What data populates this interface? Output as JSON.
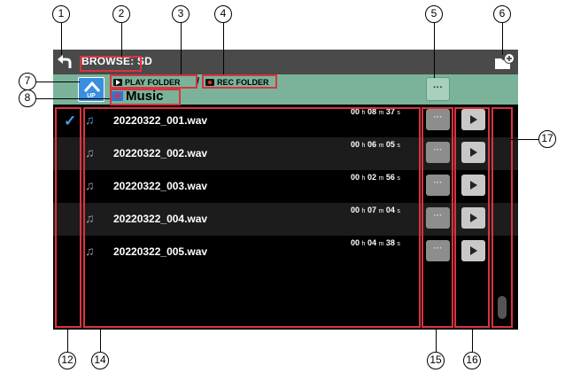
{
  "header": {
    "title": "BROWSE: SD",
    "back_icon": "back-arrow-icon",
    "new_folder_icon": "new-folder-icon"
  },
  "folder_bar": {
    "up_label": "UP",
    "play_folder_label": "PLAY FOLDER",
    "separator": "/",
    "rec_folder_label": "REC FOLDER",
    "current_folder": "Music",
    "menu_label": "···"
  },
  "files": [
    {
      "name": "20220322_001.wav",
      "h": "00",
      "m": "08",
      "s": "37",
      "selected": true
    },
    {
      "name": "20220322_002.wav",
      "h": "00",
      "m": "06",
      "s": "05",
      "selected": false
    },
    {
      "name": "20220322_003.wav",
      "h": "00",
      "m": "02",
      "s": "56",
      "selected": false
    },
    {
      "name": "20220322_004.wav",
      "h": "00",
      "m": "07",
      "s": "04",
      "selected": false
    },
    {
      "name": "20220322_005.wav",
      "h": "00",
      "m": "04",
      "s": "38",
      "selected": false
    }
  ],
  "units": {
    "h": "h",
    "m": "m",
    "s": "s"
  },
  "row_menu_label": "···",
  "callouts": {
    "c1": "1",
    "c2": "2",
    "c3": "3",
    "c4": "4",
    "c5": "5",
    "c6": "6",
    "c7": "7",
    "c8": "8",
    "c12": "12",
    "c14": "14",
    "c15": "15",
    "c16": "16",
    "c17": "17"
  },
  "colors": {
    "callout_outline": "#d9333f",
    "folder_bar": "#7ab39a",
    "accent_blue": "#4a9de0"
  }
}
